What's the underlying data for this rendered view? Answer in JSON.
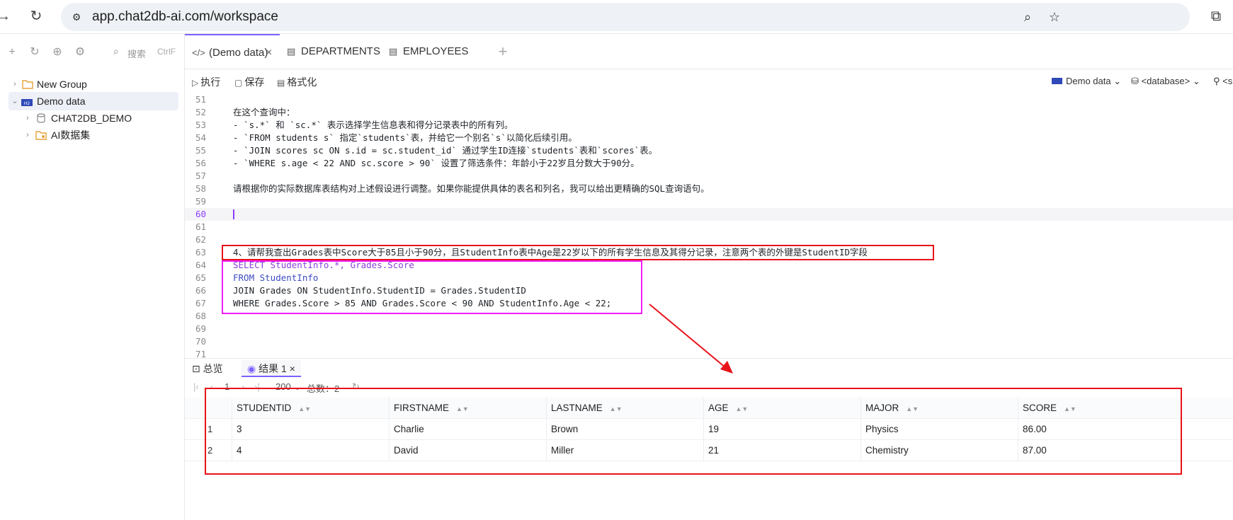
{
  "browser": {
    "url": "app.chat2db-ai.com/workspace",
    "back_icon": "arrow-right-icon",
    "reload_icon": "reload-icon"
  },
  "sidebar": {
    "search_placeholder": "搜索",
    "search_shortcut": "CtrlF",
    "tree": [
      {
        "label": "New Group",
        "icon": "folder-icon"
      },
      {
        "label": "Demo data",
        "icon": "database-badge-icon"
      },
      {
        "label": "CHAT2DB_DEMO",
        "icon": "database-icon"
      },
      {
        "label": "AI数据集",
        "icon": "ai-folder-icon"
      }
    ]
  },
  "tabs": [
    {
      "label": "(Demo data)",
      "icon": "code-icon"
    },
    {
      "label": "DEPARTMENTS",
      "icon": "table-icon"
    },
    {
      "label": "EMPLOYEES",
      "icon": "table-icon"
    }
  ],
  "actions": {
    "run": "执行",
    "save": "保存",
    "format": "格式化",
    "datasource": "Demo data",
    "database": "<database>",
    "schema": "<s"
  },
  "editor": {
    "lines": [
      {
        "n": "51",
        "text": ""
      },
      {
        "n": "52",
        "text": "在这个查询中："
      },
      {
        "n": "53",
        "text": "- `s.*` 和 `sc.*` 表示选择学生信息表和得分记录表中的所有列。"
      },
      {
        "n": "54",
        "text": "- `FROM students s` 指定`students`表，并给它一个别名`s`以简化后续引用。"
      },
      {
        "n": "55",
        "text": "- `JOIN scores sc ON s.id = sc.student_id` 通过学生ID连接`students`表和`scores`表。"
      },
      {
        "n": "56",
        "text": "- `WHERE s.age < 22 AND sc.score > 90` 设置了筛选条件：年龄小于22岁且分数大于90分。"
      },
      {
        "n": "57",
        "text": ""
      },
      {
        "n": "58",
        "text": "请根据你的实际数据库表结构对上述假设进行调整。如果你能提供具体的表名和列名，我可以给出更精确的SQL查询语句。"
      },
      {
        "n": "59",
        "text": ""
      },
      {
        "n": "60",
        "text": ""
      },
      {
        "n": "61",
        "text": ""
      },
      {
        "n": "62",
        "text": ""
      },
      {
        "n": "63",
        "text": "4、请帮我查出Grades表中Score大于85且小于90分，且StudentInfo表中Age是22岁以下的所有学生信息及其得分记录，注意两个表的外键是StudentID字段"
      },
      {
        "n": "64",
        "text": "SELECT StudentInfo.*, Grades.Score"
      },
      {
        "n": "65",
        "text": "FROM StudentInfo"
      },
      {
        "n": "66",
        "text": "JOIN Grades ON StudentInfo.StudentID = Grades.StudentID"
      },
      {
        "n": "67",
        "text": "WHERE Grades.Score > 85 AND Grades.Score < 90 AND StudentInfo.Age < 22;"
      },
      {
        "n": "68",
        "text": ""
      },
      {
        "n": "69",
        "text": ""
      },
      {
        "n": "70",
        "text": ""
      },
      {
        "n": "71",
        "text": ""
      }
    ]
  },
  "results": {
    "tab_overview": "总览",
    "tab_result": "结果 1",
    "page": "1",
    "page_size": "200",
    "row_count_label": "总数：2",
    "columns": [
      "STUDENTID",
      "FIRSTNAME",
      "LASTNAME",
      "AGE",
      "MAJOR",
      "SCORE"
    ],
    "rows": [
      {
        "idx": "1",
        "cells": [
          "3",
          "Charlie",
          "Brown",
          "19",
          "Physics",
          "86.00"
        ]
      },
      {
        "idx": "2",
        "cells": [
          "4",
          "David",
          "Miller",
          "21",
          "Chemistry",
          "87.00"
        ]
      }
    ]
  },
  "colors": {
    "accent": "#7b61ff",
    "highlight_red": "#e8121a",
    "highlight_magenta": "#f21dfc"
  }
}
